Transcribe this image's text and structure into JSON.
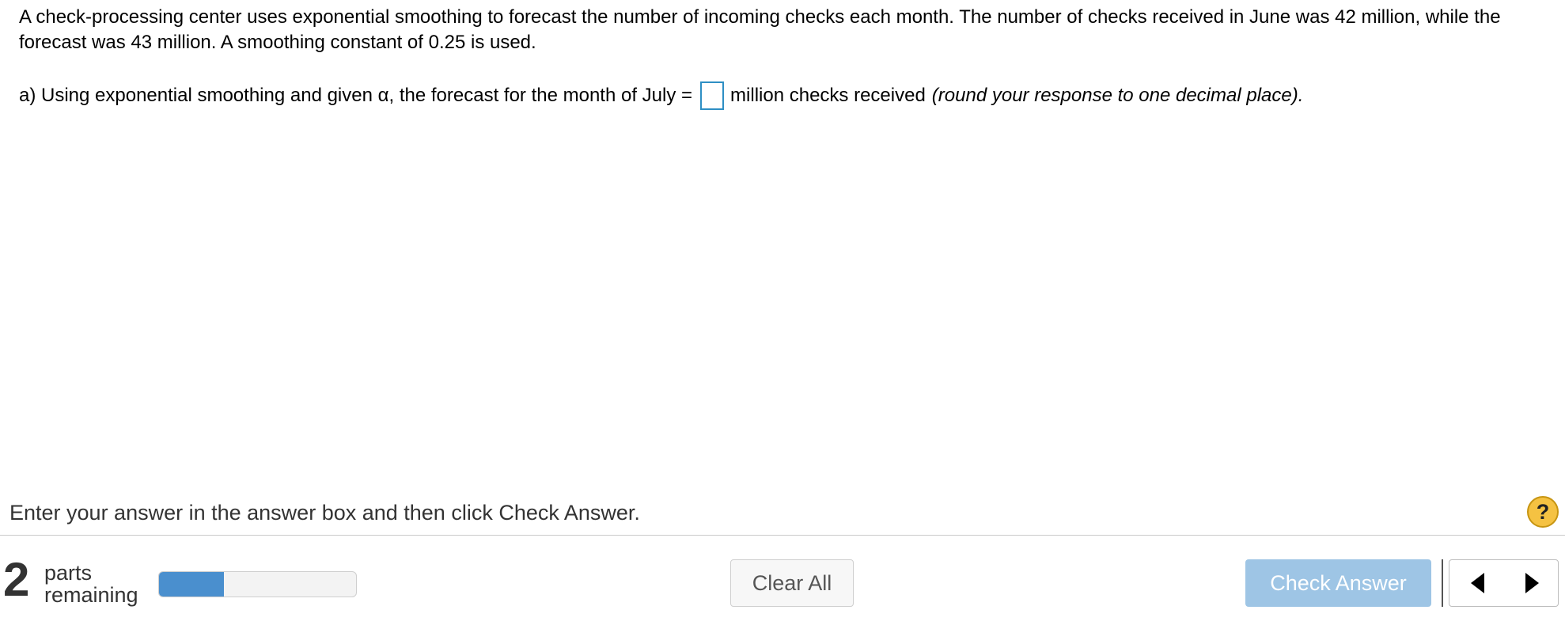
{
  "problem": {
    "statement": "A check-processing center uses exponential smoothing to forecast the number of incoming checks each month. The number of checks received in June was 42 million, while the forecast was 43 million. A smoothing constant of 0.25 is used."
  },
  "question": {
    "prefix": "a) Using exponential smoothing and given α, the forecast for the month of July =",
    "answer_value": "",
    "suffix": "million checks received",
    "hint": "(round your response to one decimal place)."
  },
  "footer": {
    "instruction": "Enter your answer in the answer box and then click Check Answer.",
    "help_label": "?",
    "parts_count": "2",
    "parts_label_1": "parts",
    "parts_label_2": "remaining",
    "progress_fraction": 0.33,
    "clear_all_label": "Clear All",
    "check_answer_label": "Check Answer",
    "icons": {
      "help": "help-icon",
      "prev": "triangle-left-icon",
      "next": "triangle-right-icon"
    },
    "colors": {
      "progress_fill": "#4a8fce",
      "check_answer_bg": "#9ec5e5",
      "help_bg": "#f5c242",
      "answer_box_border": "#2e8fc4"
    }
  }
}
